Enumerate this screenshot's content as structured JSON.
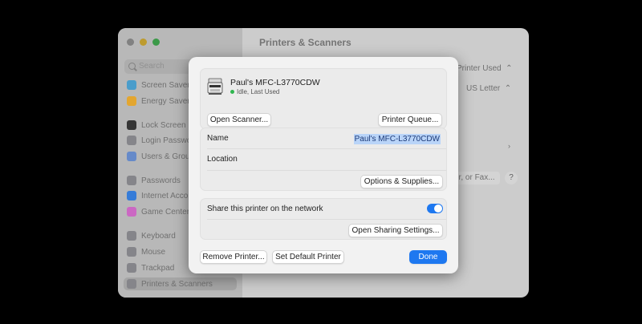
{
  "settings_window": {
    "search_placeholder": "Search",
    "title": "Printers & Scanners",
    "sidebar_items": [
      {
        "label": "Screen Saver",
        "icon": "screen-saver-icon",
        "color": "#4fa7d8"
      },
      {
        "label": "Energy Saver",
        "icon": "energy-saver-icon",
        "color": "#f2b134"
      },
      {
        "label": "Lock Screen",
        "icon": "lock-icon",
        "color": "#3a3a3a"
      },
      {
        "label": "Login Password",
        "icon": "login-password-icon",
        "color": "#8e8e93"
      },
      {
        "label": "Users & Groups",
        "icon": "users-icon",
        "color": "#6d93d6"
      },
      {
        "label": "Passwords",
        "icon": "key-icon",
        "color": "#8e8e93"
      },
      {
        "label": "Internet Accounts",
        "icon": "at-icon",
        "color": "#3a84e6"
      },
      {
        "label": "Game Center",
        "icon": "game-center-icon",
        "color": "#d86fd0"
      },
      {
        "label": "Keyboard",
        "icon": "keyboard-icon",
        "color": "#8e8e93"
      },
      {
        "label": "Mouse",
        "icon": "mouse-icon",
        "color": "#8e8e93"
      },
      {
        "label": "Trackpad",
        "icon": "trackpad-icon",
        "color": "#8e8e93"
      },
      {
        "label": "Printers & Scanners",
        "icon": "printer-icon",
        "color": "#8e8e93"
      }
    ],
    "default_printer_value": "Printer Used",
    "paper_size_value": "US Letter",
    "add_button_label": "er, or Fax...",
    "help_label": "?"
  },
  "dialog": {
    "printer_name": "Paul's MFC-L3770CDW",
    "printer_status": "Idle, Last Used",
    "open_scanner_label": "Open Scanner...",
    "printer_queue_label": "Printer Queue...",
    "name_label": "Name",
    "name_value": "Paul's MFC-L3770CDW",
    "location_label": "Location",
    "options_supplies_label": "Options & Supplies...",
    "share_label": "Share this printer on the network",
    "share_enabled": true,
    "open_sharing_label": "Open Sharing Settings...",
    "remove_printer_label": "Remove Printer...",
    "set_default_label": "Set Default Printer",
    "done_label": "Done",
    "accent_color": "#1e78f0",
    "status_color": "#30b650"
  }
}
